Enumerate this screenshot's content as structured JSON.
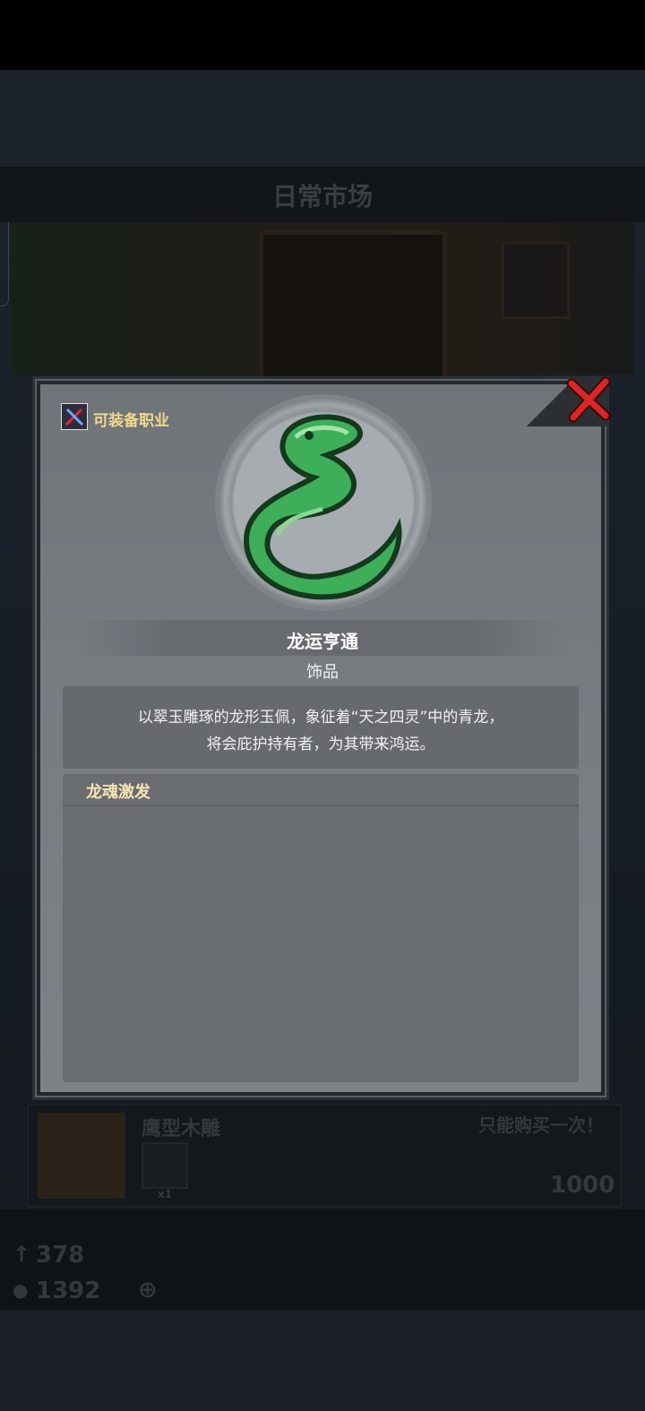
{
  "background": {
    "title": "日常市场",
    "item_name": "鹰型木雕",
    "limit_note": "只能购买一次！",
    "item_count": "x1",
    "price": "1000",
    "stat_top": "378",
    "stat_bottom": "1392"
  },
  "modal": {
    "equip_class_label": "可装备职业",
    "item_name": "龙运亨通",
    "item_type": "饰品",
    "description_lines": [
      "以翠玉雕琢的龙形玉佩，象征着“天之四灵”中的青龙，",
      "将会庇护持有者，为其带来鸿运。"
    ],
    "skill_title": "龙魂激发"
  },
  "colors": {
    "accent_gold": "#f1d88a",
    "close_red": "#d92626",
    "jade_green": "#3fae5a"
  },
  "icons": [
    "close-icon",
    "class-icon",
    "jade-dragon-pendant",
    "plus-icon",
    "arrow-icon",
    "coin-icon"
  ]
}
